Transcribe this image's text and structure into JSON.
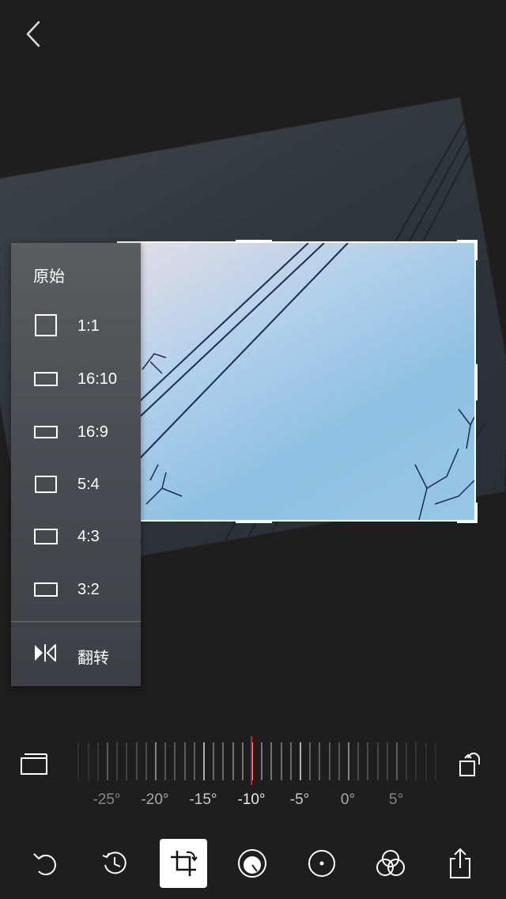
{
  "ratio_menu": {
    "title": "原始",
    "items": [
      {
        "label": "1:1",
        "w": 28,
        "h": 28
      },
      {
        "label": "16:10",
        "w": 30,
        "h": 18
      },
      {
        "label": "16:9",
        "w": 30,
        "h": 16
      },
      {
        "label": "5:4",
        "w": 28,
        "h": 22
      },
      {
        "label": "4:3",
        "w": 30,
        "h": 20
      },
      {
        "label": "3:2",
        "w": 30,
        "h": 18
      }
    ],
    "flip_label": "翻转"
  },
  "ruler": {
    "selected_angle": -10,
    "labels": [
      "-25°",
      "-20°",
      "-15°",
      "-10°",
      "-5°",
      "0°",
      "5°"
    ]
  },
  "toolbar": {
    "items": [
      "undo-icon",
      "history-icon",
      "crop-rotate-icon",
      "adjust-dial-icon",
      "vignette-icon",
      "filters-icon",
      "share-icon"
    ],
    "active": "crop-rotate-icon"
  },
  "colors": {
    "accent": "#e0151a",
    "background": "#1e1e1e"
  }
}
